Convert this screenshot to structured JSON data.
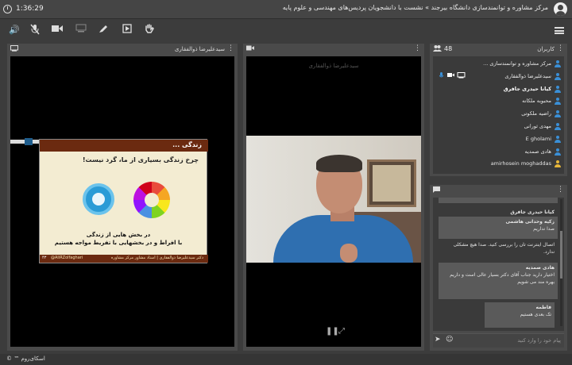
{
  "topbar": {
    "time": "1:36:29",
    "title": "مرکز مشاوره و توانمندسازی دانشگاه بیرجند » نشست با دانشجویان پردیس‌های مهندسی و علوم پایه"
  },
  "presentation": {
    "presenter_name": "سیدعلیرضا ذوالفقاری",
    "slide": {
      "header": "زندگی ...",
      "header_dots": "...",
      "title": "چرخ زندگی بسیاری از ما، گرد نیست!",
      "body_line1": "در بخش هایی از زندگی",
      "body_line2": "با افراط و در بخشهایی با تفریط مواجه هستیم",
      "footer_text": "دکتر سیدعلیرضا ذوالفقاری | استاد مشاور مرکز مشاوره",
      "handle": "@AliRZolfaghari",
      "page": "۴۳"
    }
  },
  "webcam": {
    "name": "سیدعلیرضا ذوالفقاری",
    "pause_icon": "pause-icon",
    "fullscreen_icon": "fullscreen-icon"
  },
  "users": {
    "title": "کاربران",
    "count": "48",
    "list": [
      {
        "name": "مرکز مشاوره و توانمندسازی ...",
        "bold": false,
        "gold": false,
        "media": false
      },
      {
        "name": "سیدعلیرضا ذوالفقاری",
        "bold": false,
        "gold": false,
        "media": true
      },
      {
        "name": "کیانا حیدری جافرق",
        "bold": true,
        "gold": false,
        "media": false
      },
      {
        "name": "محبوبه ملکانه",
        "bold": false,
        "gold": false,
        "media": false
      },
      {
        "name": "راضیه ملکوتی",
        "bold": false,
        "gold": false,
        "media": false
      },
      {
        "name": "مهدی ثورانی",
        "bold": false,
        "gold": false,
        "media": false
      },
      {
        "name": "E gholami",
        "bold": false,
        "gold": false,
        "media": false
      },
      {
        "name": "هادی صمدیه",
        "bold": false,
        "gold": false,
        "media": false
      },
      {
        "name": "amirhosein moghaddas",
        "bold": false,
        "gold": true,
        "media": false
      }
    ]
  },
  "chat": {
    "messages": [
      {
        "sender": "",
        "text": "",
        "bubble": true
      },
      {
        "sender": "کیانا حیدری جافرق",
        "text": "",
        "bubble": false
      },
      {
        "sender": "زکیه وحدانی هاشمی",
        "text": "صدا نداریم",
        "bubble": true
      },
      {
        "sender": "",
        "text": "اتصال اینترنت تان را بررسی کنید. صدا هیچ مشکلی ندارد.",
        "bubble": false
      },
      {
        "sender": "هادی صمدیه",
        "text": "اختیار دارید جناب آقای دکتر  بسیار عالی است و داریم بهره مند می شویم",
        "bubble": true
      },
      {
        "sender": "فاطمه",
        "text": "تک بعدی هستیم",
        "bubble": true
      }
    ],
    "input_placeholder": "پیام خود را وارد کنید"
  },
  "footer": {
    "brand": "اسکای‌روم ™ ©"
  }
}
